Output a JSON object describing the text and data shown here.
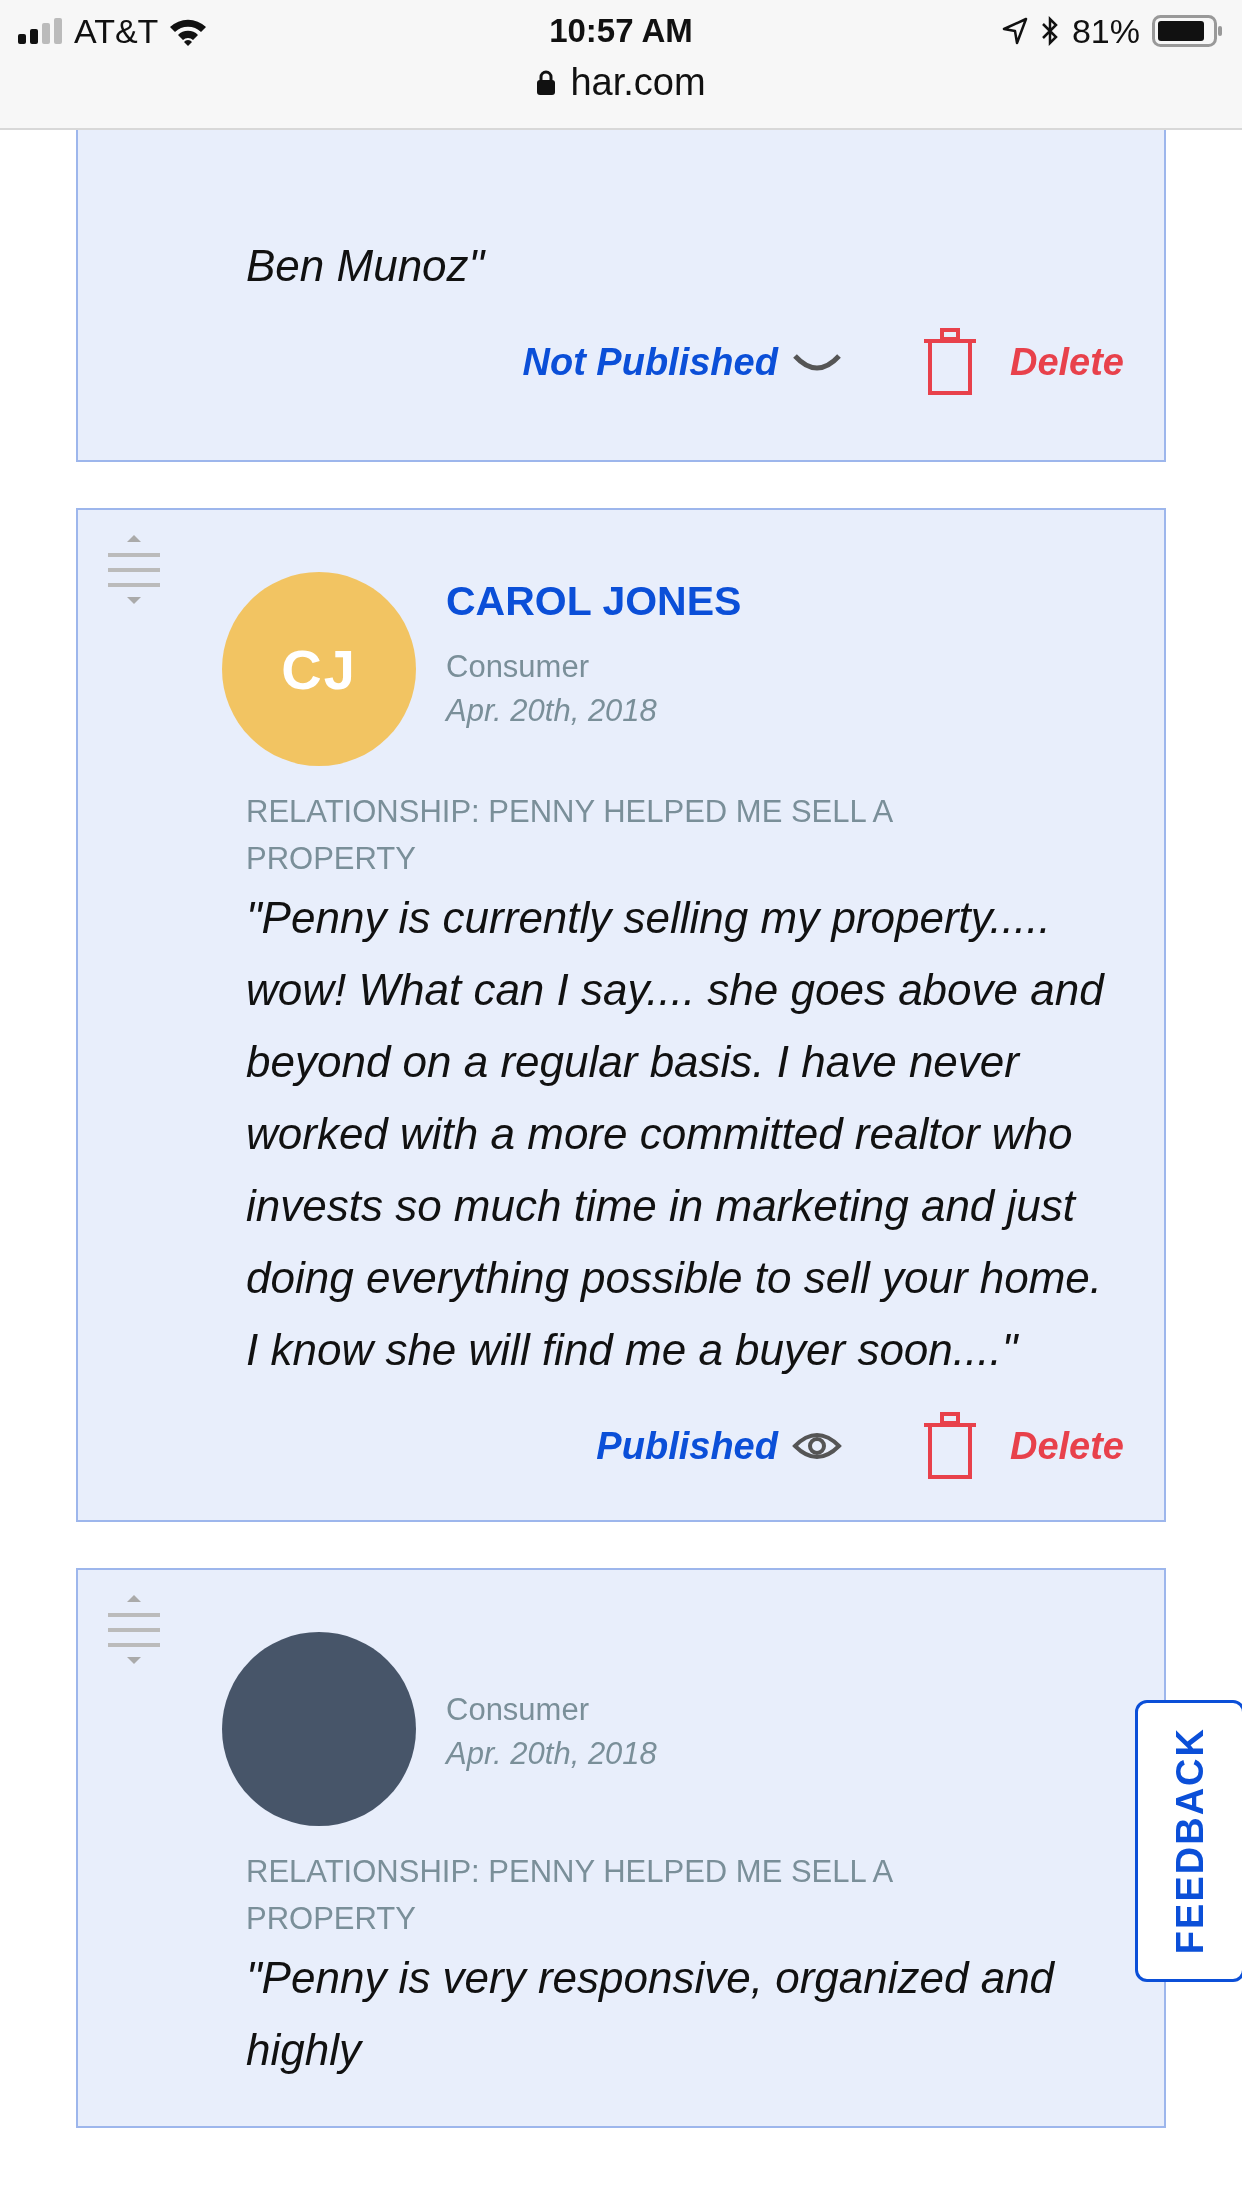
{
  "status_bar": {
    "carrier": "AT&T",
    "time": "10:57 AM",
    "url": "har.com",
    "battery": "81%"
  },
  "reviews": [
    {
      "kind": "partial",
      "quote": "Ben Munoz\"",
      "status": "Not Published",
      "published": false,
      "delete": "Delete"
    },
    {
      "kind": "full",
      "initials": "CJ",
      "color": "#f2c462",
      "name": "CAROL JONES",
      "role": "Consumer",
      "date": "Apr. 20th, 2018",
      "relationship": "RELATIONSHIP: PENNY HELPED ME SELL A PROPERTY",
      "quote": "\"Penny is currently selling my property..... wow! What can I say.... she goes above and beyond on a regular basis. I have never worked with a more committed realtor who invests so much time in marketing and just doing everything possible to sell your home. I know she will find me a buyer soon....\"",
      "status": "Published",
      "published": true,
      "delete": "Delete"
    },
    {
      "kind": "full",
      "color": "#475569",
      "role": "Consumer",
      "date": "Apr. 20th, 2018",
      "relationship": "RELATIONSHIP: PENNY HELPED ME SELL A PROPERTY",
      "quote": "\"Penny is very responsive, organized and highly"
    }
  ],
  "feedback": "FEEDBACK"
}
